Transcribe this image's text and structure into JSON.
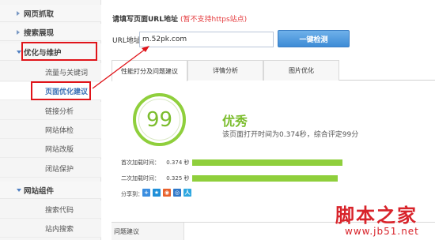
{
  "sidebar": {
    "sections": [
      {
        "label": "网页抓取"
      },
      {
        "label": "搜索展现"
      },
      {
        "label": "优化与维护"
      }
    ],
    "items": [
      {
        "label": "流量与关键词"
      },
      {
        "label": "页面优化建议"
      },
      {
        "label": "链接分析"
      },
      {
        "label": "网站体检"
      },
      {
        "label": "网站改版"
      },
      {
        "label": "闭站保护"
      }
    ],
    "section_tools": {
      "label": "网站组件"
    },
    "tool_items": [
      {
        "label": "搜索代码"
      },
      {
        "label": "站内搜索"
      }
    ]
  },
  "form": {
    "title": "请填写页面URL地址",
    "note": "(暂不支持https站点)",
    "url_label": "URL地址",
    "url_value": "m.52pk.com",
    "check_button": "一键检测"
  },
  "tabs": [
    {
      "label": "性能打分及问题建议"
    },
    {
      "label": "详情分析"
    },
    {
      "label": "图片优化"
    }
  ],
  "result": {
    "score": "99",
    "grade": "优秀",
    "description": "该页面打开时间为0.374秒，综合评定99分",
    "first_load_label": "首次加载时间：",
    "first_load_value": "0.374 秒",
    "first_load_fraction": 0.95,
    "second_load_label": "二次加载时间：",
    "second_load_value": "0.325 秒",
    "second_load_fraction": 0.92,
    "share_label": "分享到："
  },
  "share_icons": [
    {
      "name": "qzone-share-icon",
      "color": "#3b8ee0"
    },
    {
      "name": "tencent-weibo-share-icon",
      "color": "#1f8fd8"
    },
    {
      "name": "sina-weibo-share-icon",
      "color": "#e8612c"
    },
    {
      "name": "renren-share-icon",
      "color": "#2f78c9"
    },
    {
      "name": "kaixin-share-icon",
      "color": "#2ea7e0"
    }
  ],
  "issues": {
    "title": "问题建议"
  },
  "colors": {
    "accent_green": "#8fcf3c",
    "highlight_red": "#e0141a",
    "button_blue": "#3d8bd6"
  },
  "watermark": {
    "cn": "脚本之家",
    "url": "www.jb51.net"
  }
}
